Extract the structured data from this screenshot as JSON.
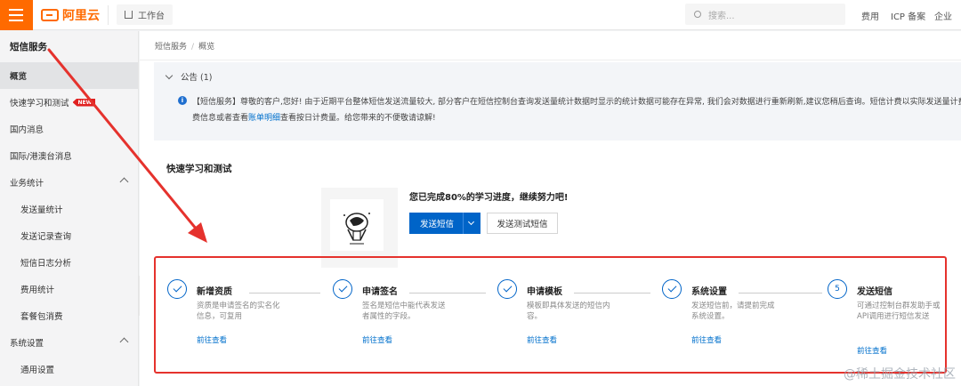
{
  "topbar": {
    "logo_text": "阿里云",
    "workbench_label": "工作台",
    "search_placeholder": "搜索...",
    "links": [
      "费用",
      "ICP 备案",
      "企业"
    ]
  },
  "sidebar": {
    "title": "短信服务",
    "items": [
      {
        "label": "概览"
      },
      {
        "label": "快速学习和测试",
        "badge": "NEW"
      },
      {
        "label": "国内消息"
      },
      {
        "label": "国际/港澳台消息"
      },
      {
        "label": "业务统计"
      },
      {
        "label": "发送量统计"
      },
      {
        "label": "发送记录查询"
      },
      {
        "label": "短信日志分析"
      },
      {
        "label": "费用统计"
      },
      {
        "label": "套餐包消费"
      },
      {
        "label": "系统设置"
      },
      {
        "label": "通用设置"
      }
    ]
  },
  "breadcrumb": {
    "root": "短信服务",
    "sep": "/",
    "current": "概览"
  },
  "notice": {
    "header": "公告 (1)",
    "line1": "【短信服务】尊敬的客户,您好! 由于近期平台整体短信发送流量较大, 部分客户在短信控制台查询发送量统计数据时显示的统计数据可能存在异常, 我们会对数据进行重新刷新,建议您稍后查询。短信计费以实际发送量计费",
    "line2_pre": "费信息或者查看",
    "line2_link": "账单明细",
    "line2_post": "查看按日计费量。给您带来的不便敬请谅解!"
  },
  "quick_learning": {
    "title": "快速学习和测试",
    "progress_text": "您已完成80%的学习进度，继续努力吧!",
    "progress_percent": 80,
    "primary_button": "发送短信",
    "secondary_button": "发送测试短信"
  },
  "steps": [
    {
      "title": "新增资质",
      "desc": "资质是申请签名的实名化信息，可复用",
      "link": "前往查看",
      "done": true
    },
    {
      "title": "申请签名",
      "desc": "签名是短信中能代表发送者属性的字段。",
      "link": "前往查看",
      "done": true
    },
    {
      "title": "申请模板",
      "desc": "模板即具体发送的短信内容。",
      "link": "前往查看",
      "done": true
    },
    {
      "title": "系统设置",
      "desc": "发送短信前，请提前完成系统设置。",
      "link": "前往查看",
      "done": true
    },
    {
      "title": "发送短信",
      "desc": "可通过控制台群发助手或API调用进行短信发送",
      "link": "前往查看",
      "done": false,
      "number": "5"
    }
  ],
  "watermark": "@稀土掘金技术社区",
  "colors": {
    "brand": "#ff6a00",
    "primary": "#0064c8",
    "annotation": "#e5322d"
  }
}
